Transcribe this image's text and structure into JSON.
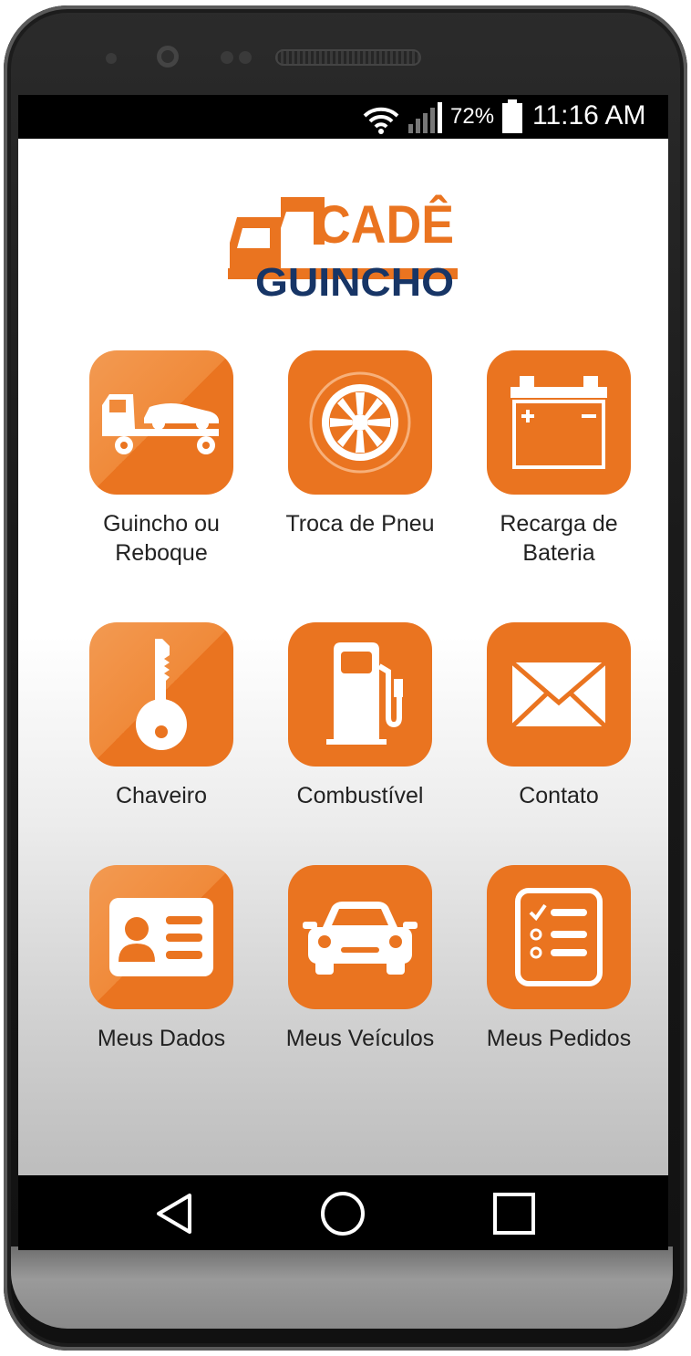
{
  "status_bar": {
    "battery": "72%",
    "time": "11:16 AM",
    "icons": [
      "wifi-icon",
      "signal-icon",
      "battery-icon"
    ]
  },
  "logo": {
    "line1": "CADÊ",
    "line2": "GUINCHO",
    "colors": {
      "orange": "#ea7420",
      "navy": "#173566"
    }
  },
  "menu": [
    {
      "label": "Guincho ou Reboque",
      "icon": "tow-truck-icon"
    },
    {
      "label": "Troca de Pneu",
      "icon": "tire-icon"
    },
    {
      "label": "Recarga de Bateria",
      "icon": "battery-charge-icon"
    },
    {
      "label": "Chaveiro",
      "icon": "key-icon"
    },
    {
      "label": "Combustível",
      "icon": "fuel-pump-icon"
    },
    {
      "label": "Contato",
      "icon": "envelope-icon"
    },
    {
      "label": "Meus Dados",
      "icon": "id-card-icon"
    },
    {
      "label": "Meus Veículos",
      "icon": "car-icon"
    },
    {
      "label": "Meus Pedidos",
      "icon": "checklist-icon"
    }
  ],
  "nav_bar": {
    "icons": [
      "back-icon",
      "home-icon",
      "recents-icon"
    ]
  },
  "theme": {
    "accent": "#ea7420",
    "accent_light": "#f39a52"
  }
}
